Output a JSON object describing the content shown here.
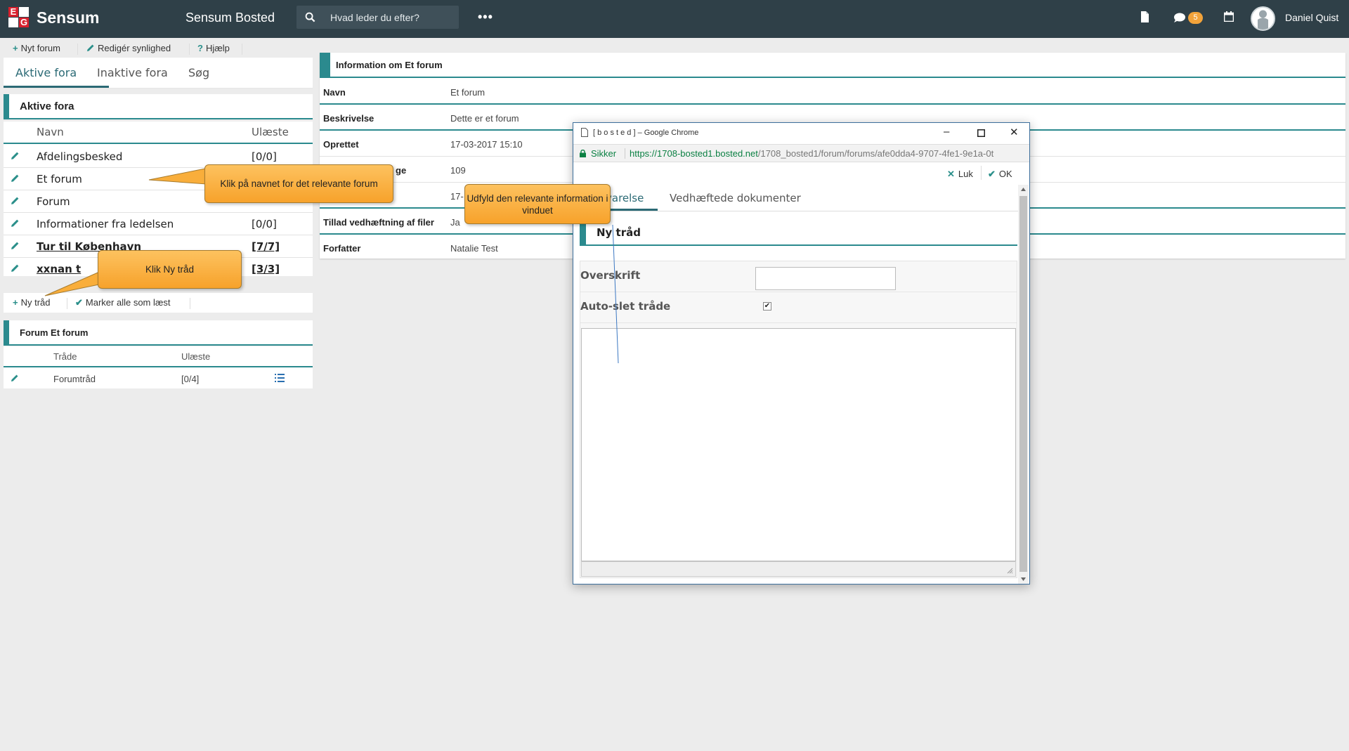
{
  "header": {
    "brand": "Sensum",
    "app_title": "Sensum Bosted",
    "search_placeholder": "Hvad leder du efter?",
    "more_label": "•••",
    "notification_count": "5",
    "user_name": "Daniel Quist",
    "icons": [
      "document-icon",
      "chat-icon",
      "calendar-icon",
      "user-avatar"
    ],
    "colors": {
      "bar": "#2f4048",
      "badge": "#f2a33a"
    }
  },
  "logo": {
    "letters": [
      "E",
      "G"
    ]
  },
  "toolbar": {
    "new_forum": "Nyt forum",
    "edit_visibility": "Redigér synlighed",
    "help": "Hjælp"
  },
  "tabs": {
    "active": "Aktive fora",
    "inactive": "Inaktive fora",
    "search": "Søg"
  },
  "fora": {
    "title": "Aktive fora",
    "col_name": "Navn",
    "col_unread": "Ulæste",
    "rows": [
      {
        "name": "Afdelingsbesked",
        "unread": "[0/0]"
      },
      {
        "name": "Et forum",
        "unread": ""
      },
      {
        "name": "Forum",
        "unread": ""
      },
      {
        "name": "Informationer fra ledelsen",
        "unread": "[0/0]"
      },
      {
        "name": "Tur til København",
        "unread": "[7/7]"
      },
      {
        "name": "xxnan t",
        "unread": "[3/3]"
      }
    ]
  },
  "toolbar2": {
    "new_thread": "Ny tråd",
    "mark_all_read": "Marker alle som læst"
  },
  "threads": {
    "title": "Forum Et forum",
    "col_thread": "Tråde",
    "col_unread": "Ulæste",
    "rows": [
      {
        "name": "Forumtråd",
        "unread": "[0/4]"
      }
    ]
  },
  "info": {
    "title": "Information om Et forum",
    "rows": [
      {
        "label": "Navn",
        "value": "Et forum"
      },
      {
        "label": "Beskrivelse",
        "value": "Dette er et forum"
      },
      {
        "label": "Oprettet",
        "value": "17-03-2017 15:10"
      },
      {
        "label": "ge",
        "value": "109"
      },
      {
        "label": "",
        "value": "17-"
      },
      {
        "label": "Tillad vedhæftning af filer",
        "value": "Ja"
      },
      {
        "label": "Forfatter",
        "value": "Natalie Test"
      }
    ],
    "accent": "#2b8a8e"
  },
  "popup": {
    "window_title": "[ b o s t e d ] – Google Chrome",
    "secure_label": "Sikker",
    "url_host": "https://1708-bosted1.bosted.net",
    "url_path": "/1708_bosted1/forum/forums/afe0dda4-9707-4fe1-9e1a-0t",
    "close_label": "Luk",
    "ok_label": "OK",
    "tab_description": "varelse",
    "tab_attachments": "Vedhæftede dokumenter",
    "section_title": "Ny tråd",
    "field_headline": "Overskrift",
    "field_autodelete": "Auto-slet tråde",
    "autodelete_checked": "✔"
  },
  "callouts": {
    "click_forum": "Klik på navnet for det relevante forum",
    "fill_info": "Udfyld den relevante information i vinduet",
    "click_new_thread": "Klik Ny tråd"
  }
}
